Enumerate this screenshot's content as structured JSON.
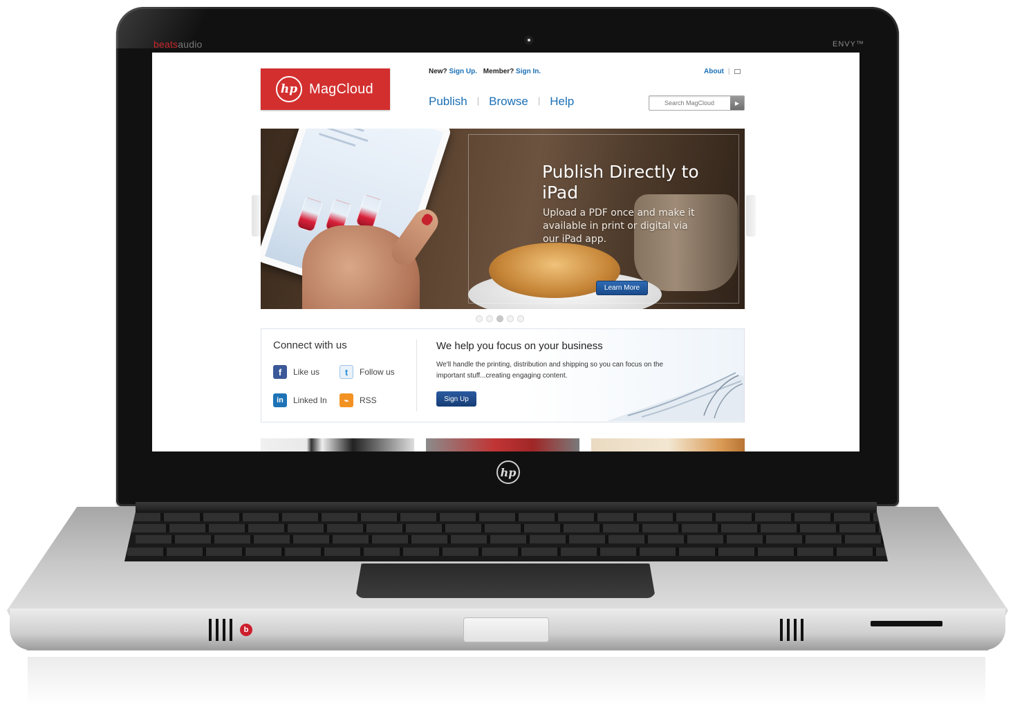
{
  "device": {
    "audio_brand_accent": "beats",
    "audio_brand_rest": "audio",
    "model_label": "ENVY™",
    "lid_logo": "hp"
  },
  "site": {
    "logo": {
      "mark": "hp",
      "name": "MagCloud"
    },
    "account": {
      "new_prefix": "New?",
      "signup_link": "Sign Up.",
      "member_prefix": "Member?",
      "signin_link": "Sign In."
    },
    "about_label": "About",
    "nav": [
      {
        "label": "Publish"
      },
      {
        "label": "Browse"
      },
      {
        "label": "Help"
      }
    ],
    "search": {
      "placeholder": "Search MagCloud",
      "icon": "arrow-right-icon"
    },
    "hero": {
      "title": "Publish Directly to iPad",
      "subtitle": "Upload a PDF once and make it available in print or digital via our iPad app.",
      "button_label": "Learn More",
      "slides_total": 5,
      "active_slide": 3
    },
    "connect": {
      "title": "Connect with us",
      "items": [
        {
          "label": "Like us",
          "icon": "facebook-icon",
          "glyph": "f"
        },
        {
          "label": "Follow us",
          "icon": "twitter-icon",
          "glyph": "t"
        },
        {
          "label": "Linked In",
          "icon": "linkedin-icon",
          "glyph": "in"
        },
        {
          "label": "RSS",
          "icon": "rss-icon",
          "glyph": "⌁"
        }
      ]
    },
    "promo": {
      "title": "We help you focus on your business",
      "body": "We'll handle the printing, distribution and shipping so you can focus on the important stuff...creating engaging content.",
      "button_label": "Sign Up"
    }
  },
  "colors": {
    "brand_red": "#d32f2f",
    "link_blue": "#1a6fb5",
    "button_blue": "#1a4c8c"
  }
}
